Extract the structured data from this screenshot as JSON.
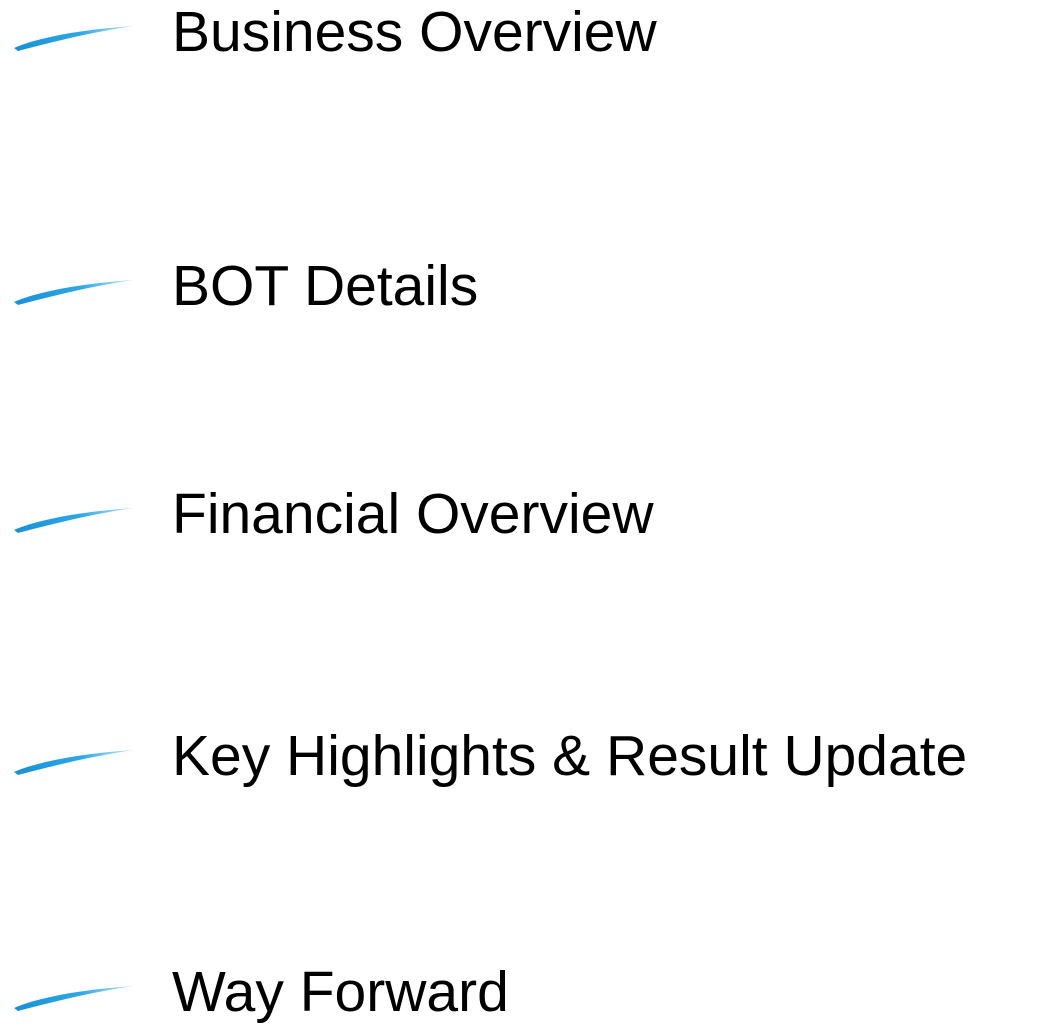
{
  "agenda": {
    "items": [
      {
        "label": "Business Overview",
        "icon": "blue-swoosh-icon"
      },
      {
        "label": "BOT Details",
        "icon": "blue-swoosh-icon"
      },
      {
        "label": "Financial Overview",
        "icon": "blue-swoosh-icon"
      },
      {
        "label": "Key Highlights & Result Update",
        "icon": "blue-swoosh-icon"
      },
      {
        "label": "Way Forward",
        "icon": "blue-swoosh-icon"
      }
    ]
  },
  "colors": {
    "swoosh_accent": "#1e9ee0",
    "swoosh_light": "#8fd4f5",
    "text": "#000000",
    "background": "#ffffff"
  }
}
